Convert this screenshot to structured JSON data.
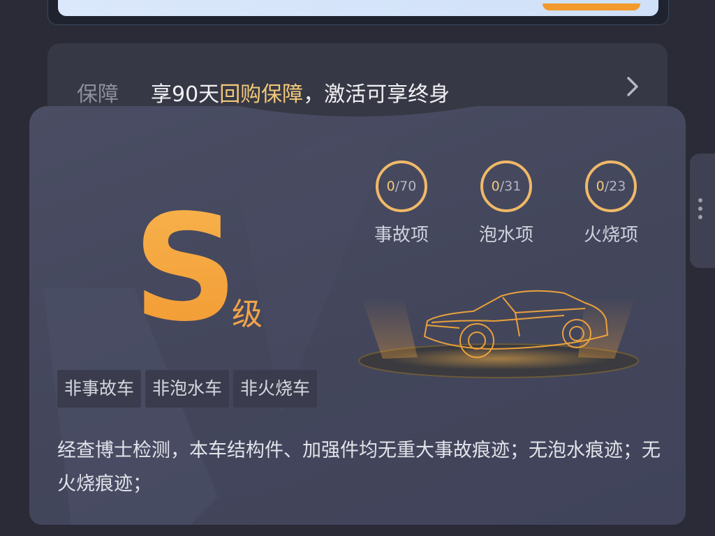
{
  "guarantee": {
    "label": "保障",
    "text_before": "享90天",
    "text_highlight": "回购保障",
    "text_after": "，激活可享终身"
  },
  "grade": {
    "letter": "S",
    "suffix": "级"
  },
  "counters": [
    {
      "num": "0",
      "total": "/70",
      "label": "事故项"
    },
    {
      "num": "0",
      "total": "/31",
      "label": "泡水项"
    },
    {
      "num": "0",
      "total": "/23",
      "label": "火烧项"
    }
  ],
  "tags": [
    "非事故车",
    "非泡水车",
    "非火烧车"
  ],
  "description": "经查博士检测，本车结构件、加强件均无重大事故痕迹；无泡水痕迹；无火烧痕迹；",
  "colors": {
    "accent_orange": "#f29b34",
    "highlight_gold": "#f2c97a",
    "card_bg": "#464960"
  },
  "icons": {
    "guarantee_arrow": "chevron-right-icon",
    "side_menu": "more-vertical-icon",
    "car": "car-illustration"
  }
}
